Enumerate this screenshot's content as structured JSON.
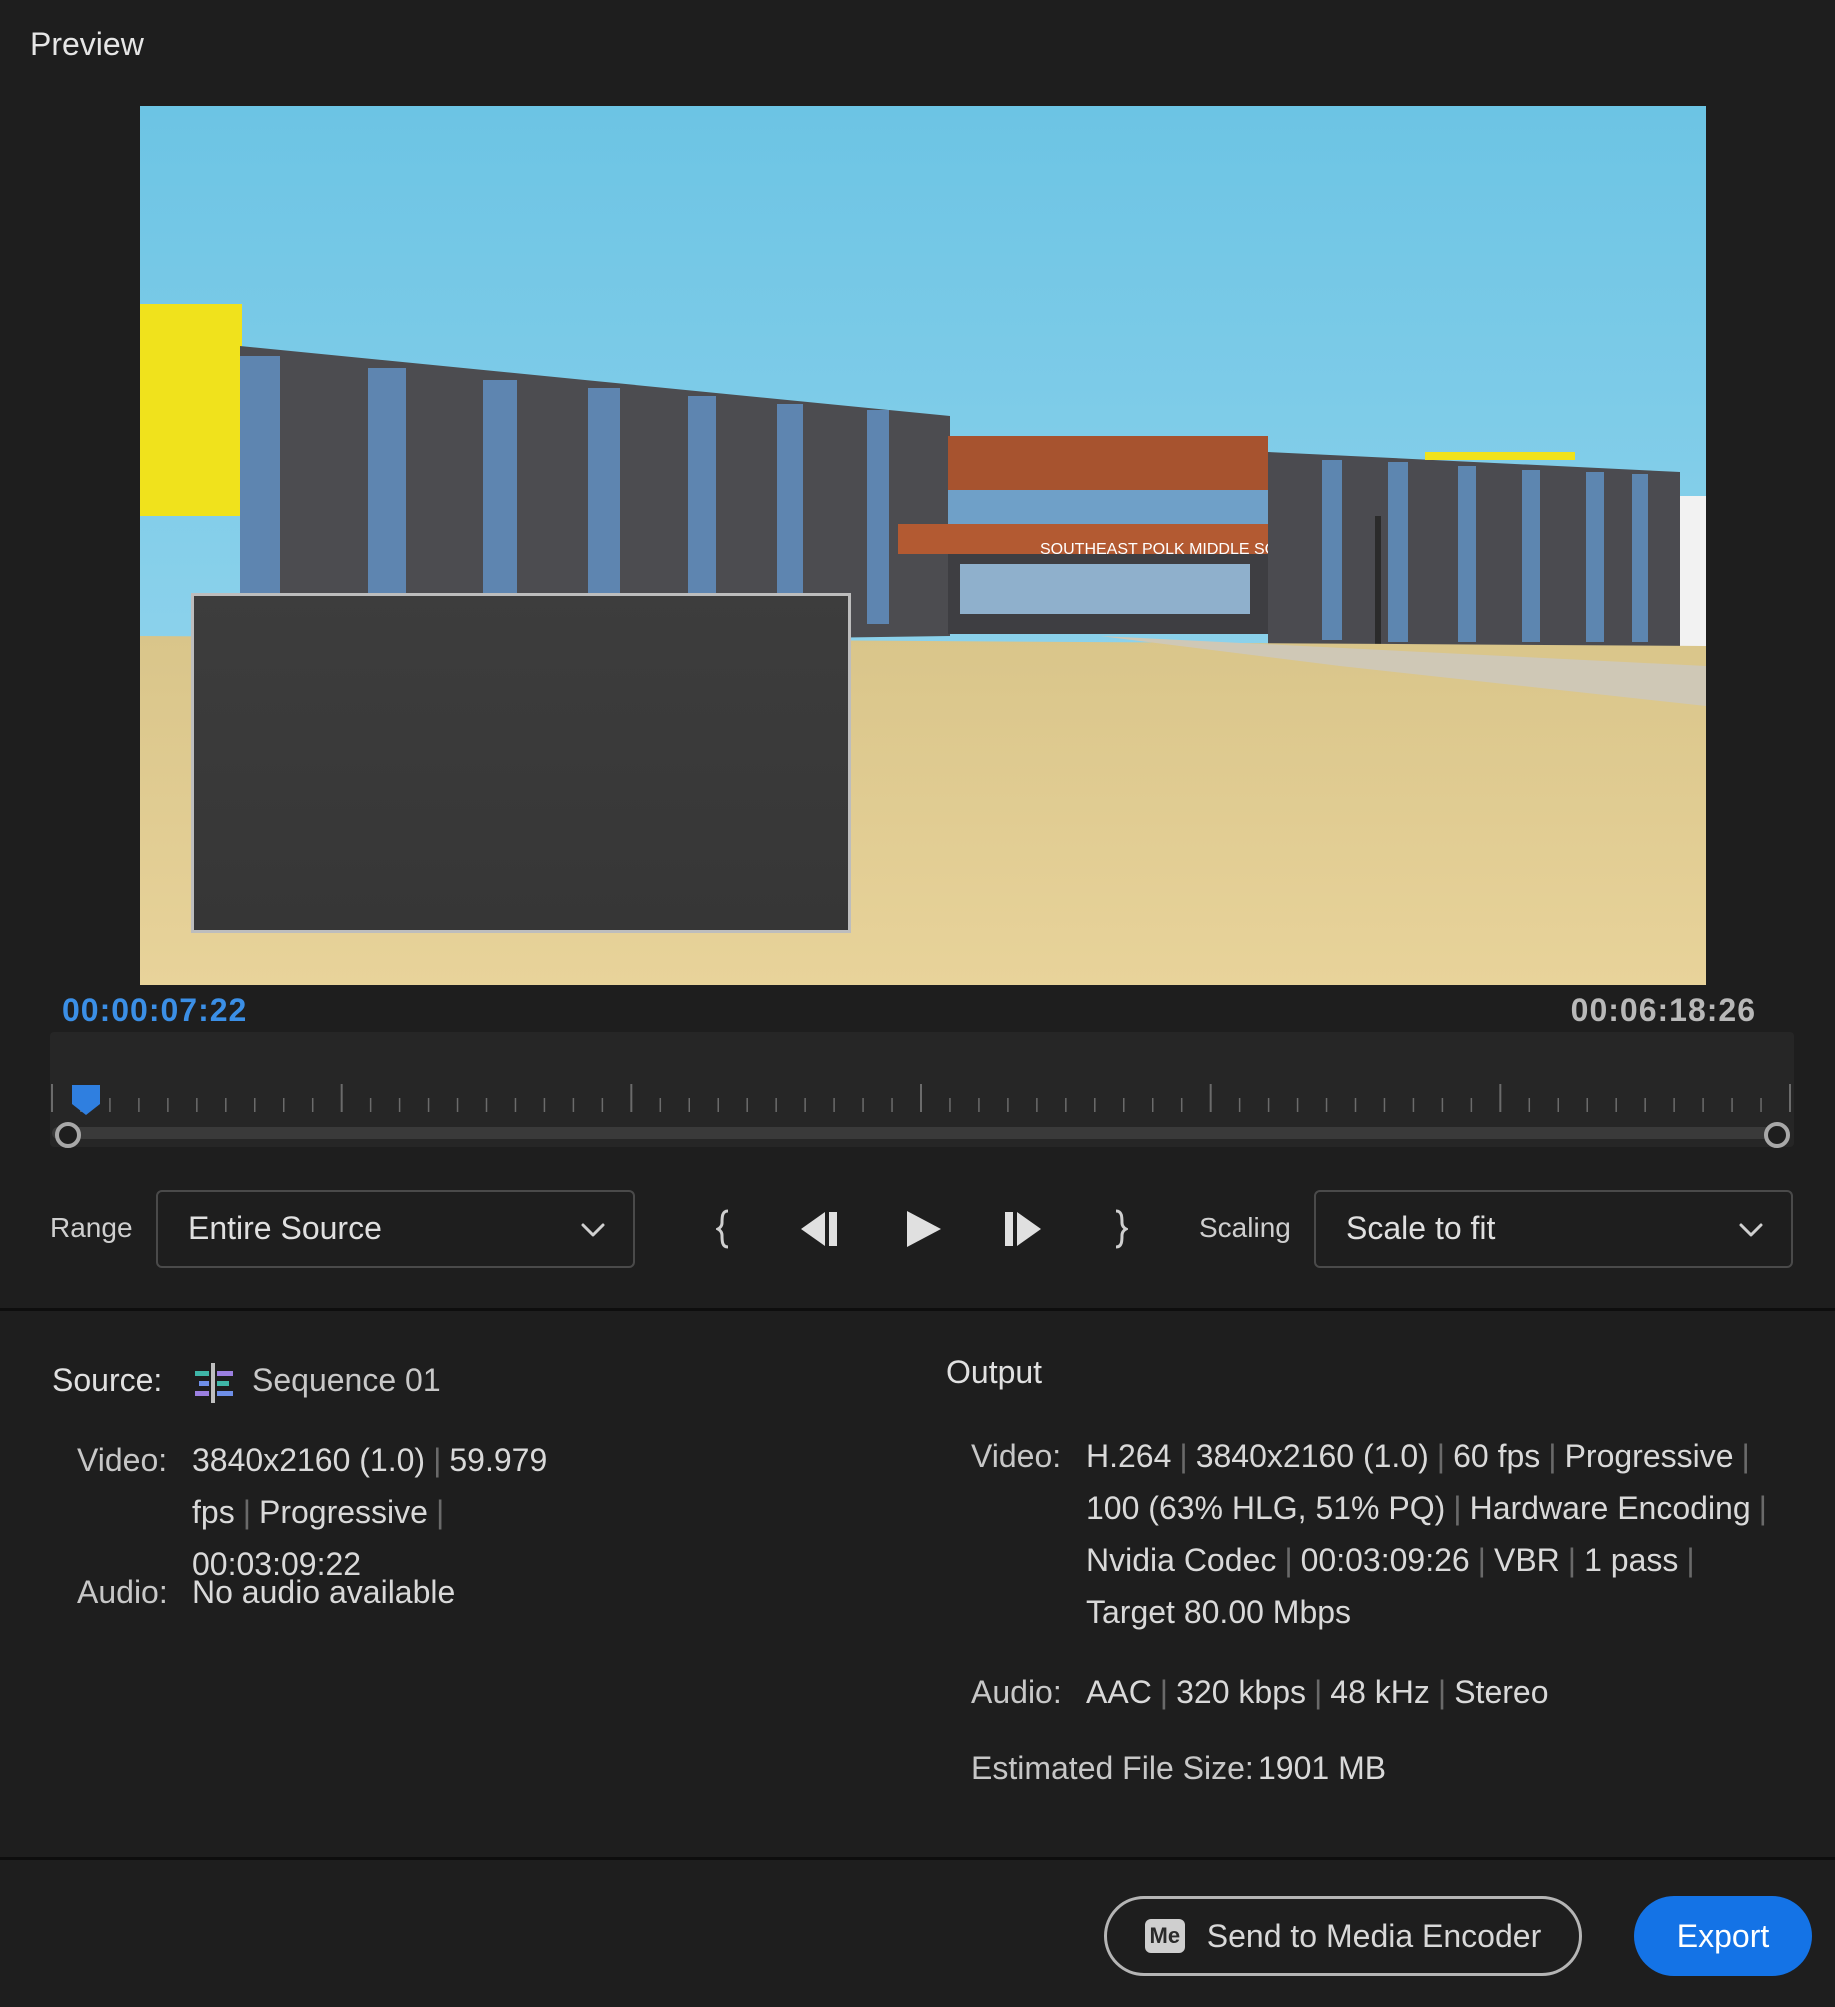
{
  "preview": {
    "title": "Preview",
    "sign_text": "SOUTHEAST POLK MIDDLE SCHOOL",
    "timecode_current": "00:00:07:22",
    "timecode_duration": "00:06:18:26"
  },
  "controls": {
    "range_label": "Range",
    "range_value": "Entire Source",
    "scaling_label": "Scaling",
    "scaling_value": "Scale to fit"
  },
  "source": {
    "label": "Source:",
    "sequence_name": "Sequence 01",
    "video_key": "Video:",
    "video_parts": [
      "3840x2160 (1.0)",
      "59.979 fps",
      "Progressive"
    ],
    "video_duration": "00:03:09:22",
    "audio_key": "Audio:",
    "audio_value": "No audio available"
  },
  "output": {
    "label": "Output",
    "video_key": "Video:",
    "video_line1": [
      "H.264",
      "3840x2160 (1.0)",
      "60 fps",
      "Progressive"
    ],
    "video_line2": [
      "100 (63% HLG, 51% PQ)",
      "Hardware Encoding"
    ],
    "video_line3": [
      "Nvidia Codec",
      "00:03:09:26",
      "VBR",
      "1 pass"
    ],
    "video_line4": "Target 80.00 Mbps",
    "audio_key": "Audio:",
    "audio_parts": [
      "AAC",
      "320 kbps",
      "48 kHz",
      "Stereo"
    ],
    "file_size_key": "Estimated File Size:",
    "file_size_value": "1901 MB"
  },
  "buttons": {
    "send_to_me": "Send to Media Encoder",
    "me_badge": "Me",
    "export": "Export"
  },
  "colors": {
    "accent": "#1473e6",
    "timecode_current": "#3b8fe6",
    "background": "#1e1e1e"
  },
  "icons": {
    "sequence": "sequence-icon",
    "mark_in": "mark-in-icon",
    "step_back": "step-back-icon",
    "play": "play-icon",
    "step_forward": "step-forward-icon",
    "mark_out": "mark-out-icon",
    "dropdown": "chevron-down-icon"
  }
}
